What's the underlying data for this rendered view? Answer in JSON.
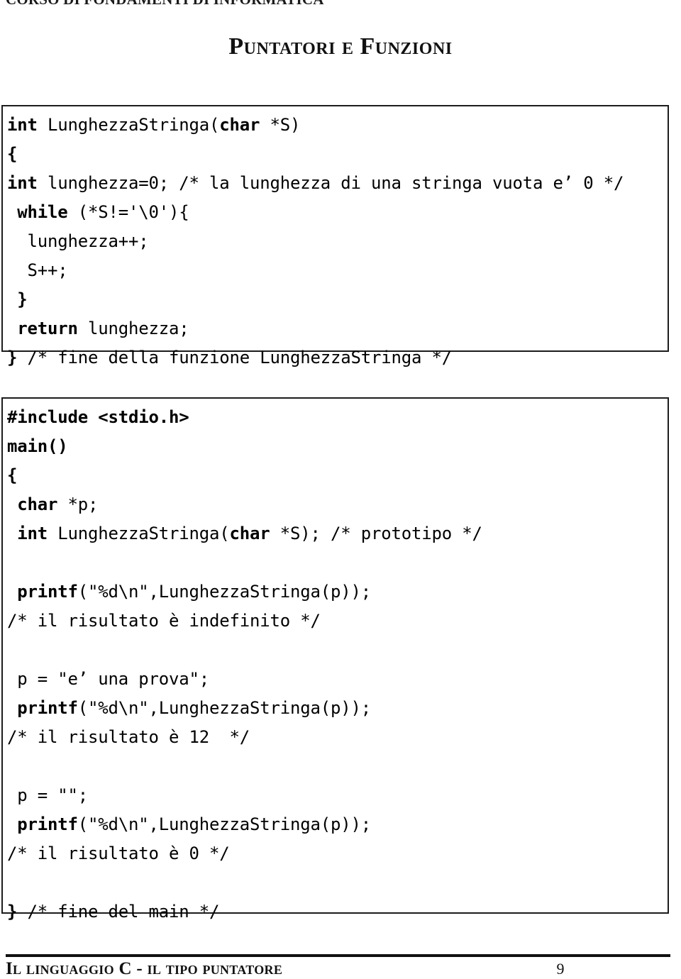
{
  "header": {
    "running_head": "CORSO DI FONDAMENTI DI INFORMATICA"
  },
  "title": "Puntatori e Funzioni",
  "code_blocks": [
    {
      "id": "function-definition-block",
      "lines": [
        [
          {
            "t": "int",
            "b": true
          },
          {
            "t": " LunghezzaStringa(",
            "b": false
          },
          {
            "t": "char",
            "b": true
          },
          {
            "t": " *S)",
            "b": false
          }
        ],
        [
          {
            "t": "{",
            "b": true
          }
        ],
        [
          {
            "t": "int",
            "b": true
          },
          {
            "t": " lunghezza=0; /* la lunghezza di una stringa vuota e’ 0 */",
            "b": false
          }
        ],
        [
          {
            "t": " ",
            "b": false
          },
          {
            "t": "while",
            "b": true
          },
          {
            "t": " (*S!='\\0'){",
            "b": false
          }
        ],
        [
          {
            "t": "  lunghezza++;",
            "b": false
          }
        ],
        [
          {
            "t": "  S++;",
            "b": false
          }
        ],
        [
          {
            "t": " }",
            "b": true
          }
        ],
        [
          {
            "t": " ",
            "b": false
          },
          {
            "t": "return",
            "b": true
          },
          {
            "t": " lunghezza;",
            "b": false
          }
        ],
        [
          {
            "t": "}",
            "b": true
          },
          {
            "t": " /* fine della funzione LunghezzaStringa */",
            "b": false
          }
        ]
      ]
    },
    {
      "id": "main-program-block",
      "lines": [
        [
          {
            "t": "#include <stdio.h>",
            "b": true
          }
        ],
        [
          {
            "t": "main()",
            "b": true
          }
        ],
        [
          {
            "t": "{",
            "b": true
          }
        ],
        [
          {
            "t": " ",
            "b": false
          },
          {
            "t": "char",
            "b": true
          },
          {
            "t": " *p;",
            "b": false
          }
        ],
        [
          {
            "t": " ",
            "b": false
          },
          {
            "t": "int",
            "b": true
          },
          {
            "t": " LunghezzaStringa(",
            "b": false
          },
          {
            "t": "char",
            "b": true
          },
          {
            "t": " *S); /* prototipo */",
            "b": false
          }
        ],
        [
          {
            "t": "",
            "b": false
          }
        ],
        [
          {
            "t": " ",
            "b": false
          },
          {
            "t": "printf",
            "b": true
          },
          {
            "t": "(\"%d\\n\",LunghezzaStringa(p));",
            "b": false
          }
        ],
        [
          {
            "t": "/* il risultato è indefinito */",
            "b": false
          }
        ],
        [
          {
            "t": "",
            "b": false
          }
        ],
        [
          {
            "t": " p = \"e’ una prova\";",
            "b": false
          }
        ],
        [
          {
            "t": " ",
            "b": false
          },
          {
            "t": "printf",
            "b": true
          },
          {
            "t": "(\"%d\\n\",LunghezzaStringa(p));",
            "b": false
          }
        ],
        [
          {
            "t": "/* il risultato è 12  */",
            "b": false
          }
        ],
        [
          {
            "t": "",
            "b": false
          }
        ],
        [
          {
            "t": " p = \"\";",
            "b": false
          }
        ],
        [
          {
            "t": " ",
            "b": false
          },
          {
            "t": "printf",
            "b": true
          },
          {
            "t": "(\"%d\\n\",LunghezzaStringa(p));",
            "b": false
          }
        ],
        [
          {
            "t": "/* il risultato è 0 */",
            "b": false
          }
        ],
        [
          {
            "t": "",
            "b": false
          }
        ],
        [
          {
            "t": "}",
            "b": true
          },
          {
            "t": " /* fine del main */",
            "b": false
          }
        ]
      ]
    }
  ],
  "footer": {
    "title": "Il linguaggio C - il tipo puntatore",
    "page_number": "9"
  }
}
